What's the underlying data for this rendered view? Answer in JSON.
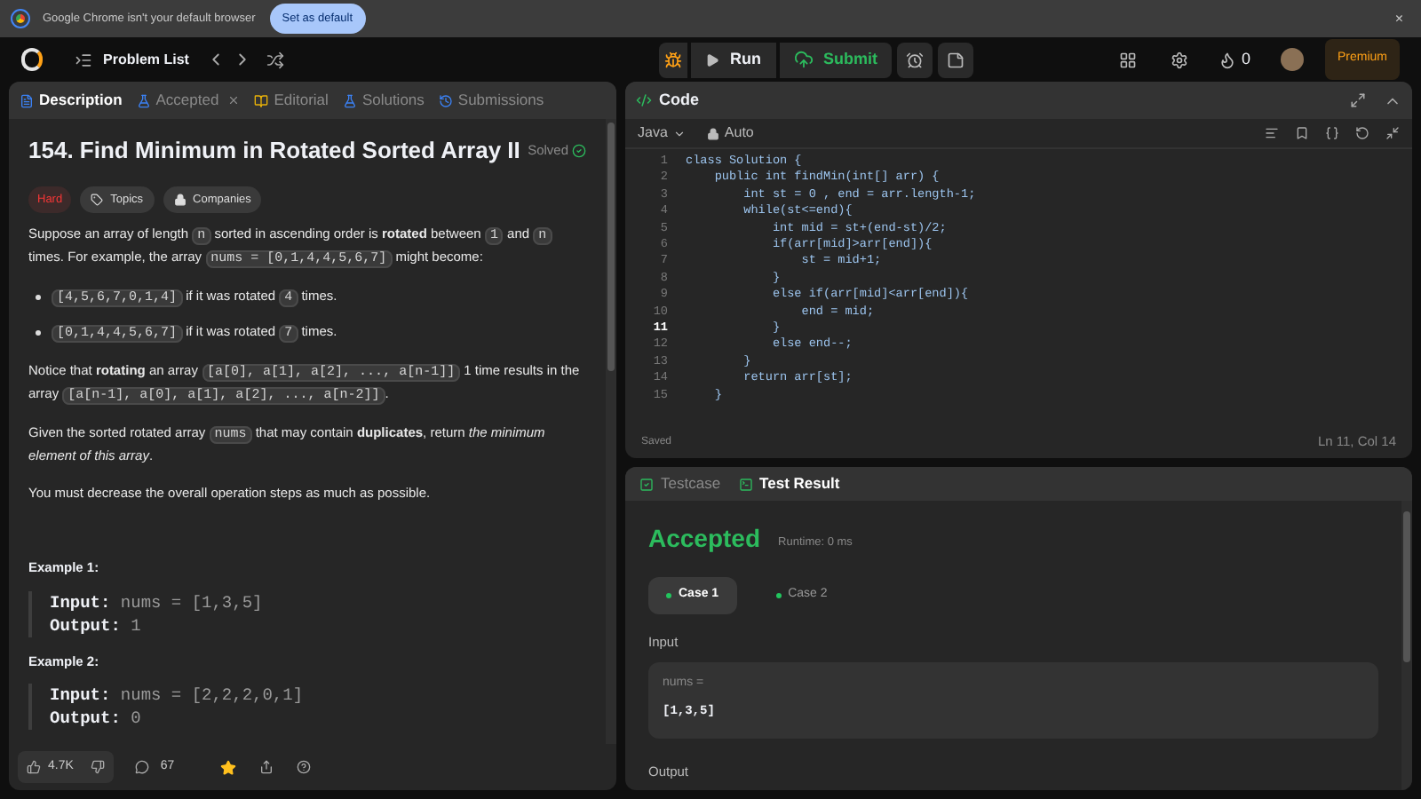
{
  "browser_bar": {
    "message": "Google Chrome isn't your default browser",
    "button": "Set as default",
    "close": "×"
  },
  "nav": {
    "problem_list": "Problem List",
    "run": "Run",
    "submit": "Submit",
    "streak": "0",
    "premium": "Premium"
  },
  "left_tabs": [
    {
      "label": "Description",
      "selected": true,
      "closable": false,
      "color": "#3b82f6"
    },
    {
      "label": "Accepted",
      "selected": false,
      "closable": true,
      "color": "#3b82f6"
    },
    {
      "label": "Editorial",
      "selected": false,
      "closable": false,
      "color": "#eab308"
    },
    {
      "label": "Solutions",
      "selected": false,
      "closable": false,
      "color": "#3b82f6"
    },
    {
      "label": "Submissions",
      "selected": false,
      "closable": false,
      "color": "#3b82f6"
    }
  ],
  "problem": {
    "title": "154. Find Minimum in Rotated Sorted Array II",
    "status": "Solved",
    "difficulty": "Hard",
    "tags": [
      "Topics",
      "Companies"
    ],
    "paragraphs": [
      [
        {
          "kind": "text",
          "text": "Suppose an array of length "
        },
        {
          "kind": "code",
          "text": "n"
        },
        {
          "kind": "text",
          "text": " sorted in ascending order is **rotated** between "
        },
        {
          "kind": "code",
          "text": "1"
        },
        {
          "kind": "text",
          "text": " and "
        },
        {
          "kind": "code",
          "text": "n"
        },
        {
          "kind": "text",
          "text": " times. For example, the array "
        },
        {
          "kind": "code",
          "text": "nums = [0,1,4,4,5,6,7]"
        },
        {
          "kind": "text",
          "text": " might become:"
        }
      ]
    ],
    "bullets": [
      [
        {
          "kind": "code",
          "text": "[4,5,6,7,0,1,4]"
        },
        {
          "kind": "text",
          "text": " if it was rotated "
        },
        {
          "kind": "code",
          "text": "4"
        },
        {
          "kind": "text",
          "text": " times."
        }
      ],
      [
        {
          "kind": "code",
          "text": "[0,1,4,4,5,6,7]"
        },
        {
          "kind": "text",
          "text": " if it was rotated "
        },
        {
          "kind": "code",
          "text": "7"
        },
        {
          "kind": "text",
          "text": " times."
        }
      ]
    ],
    "paragraphs_after": [
      [
        {
          "kind": "text",
          "text": "Notice that **rotating** an array "
        },
        {
          "kind": "code",
          "text": "[a[0], a[1], a[2], ..., a[n-1]]"
        },
        {
          "kind": "text",
          "text": " 1 time results in the array "
        },
        {
          "kind": "code",
          "text": "[a[n-1], a[0], a[1], a[2], ..., a[n-2]]"
        },
        {
          "kind": "text",
          "text": "."
        }
      ],
      [
        {
          "kind": "text",
          "text": "Given the sorted rotated array "
        },
        {
          "kind": "code",
          "text": "nums"
        },
        {
          "kind": "text",
          "text": " that may contain **duplicates**, return *the minimum element of this array*."
        }
      ],
      [
        {
          "kind": "text",
          "text": "You must decrease the overall operation steps as much as possible."
        }
      ]
    ],
    "examples": [
      {
        "title": "Example 1:",
        "input_label": "Input:",
        "input": "nums = [1,3,5]",
        "output_label": "Output:",
        "output": "1"
      },
      {
        "title": "Example 2:",
        "input_label": "Input:",
        "input": "nums = [2,2,2,0,1]",
        "output_label": "Output:",
        "output": "0"
      }
    ]
  },
  "footer": {
    "likes": "4.7K",
    "comments": "67",
    "favorited": true
  },
  "code_panel": {
    "title": "Code",
    "language": "Java",
    "mode": "Auto",
    "lines": [
      {
        "number": "1",
        "text": "class Solution {",
        "current": false
      },
      {
        "number": "2",
        "text": "    public int findMin(int[] arr) {",
        "current": false
      },
      {
        "number": "3",
        "text": "        int st = 0 , end = arr.length-1;",
        "current": false
      },
      {
        "number": "4",
        "text": "        while(st<=end){",
        "current": false
      },
      {
        "number": "5",
        "text": "            int mid = st+(end-st)/2;",
        "current": false
      },
      {
        "number": "6",
        "text": "            if(arr[mid]>arr[end]){",
        "current": false
      },
      {
        "number": "7",
        "text": "                st = mid+1;",
        "current": false
      },
      {
        "number": "8",
        "text": "            }",
        "current": false
      },
      {
        "number": "9",
        "text": "            else if(arr[mid]<arr[end]){",
        "current": false
      },
      {
        "number": "10",
        "text": "                end = mid;",
        "current": false
      },
      {
        "number": "11",
        "text": "            }",
        "current": true
      },
      {
        "number": "12",
        "text": "            else end--;",
        "current": false
      },
      {
        "number": "13",
        "text": "        }",
        "current": false
      },
      {
        "number": "14",
        "text": "        return arr[st];",
        "current": false
      },
      {
        "number": "15",
        "text": "    }",
        "current": false
      }
    ],
    "saved": "Saved",
    "cursor": "Ln 11, Col 14"
  },
  "result_tabs": [
    {
      "label": "Testcase",
      "selected": false
    },
    {
      "label": "Test Result",
      "selected": true
    }
  ],
  "result": {
    "verdict": "Accepted",
    "runtime": "Runtime: 0 ms",
    "cases": [
      {
        "label": "Case 1",
        "selected": true,
        "color": "#22c55e"
      },
      {
        "label": "Case 2",
        "selected": false,
        "color": "#22c55e"
      }
    ],
    "input_label": "Input",
    "input_name": "nums =",
    "input_value": "[1,3,5]",
    "output_label": "Output"
  }
}
